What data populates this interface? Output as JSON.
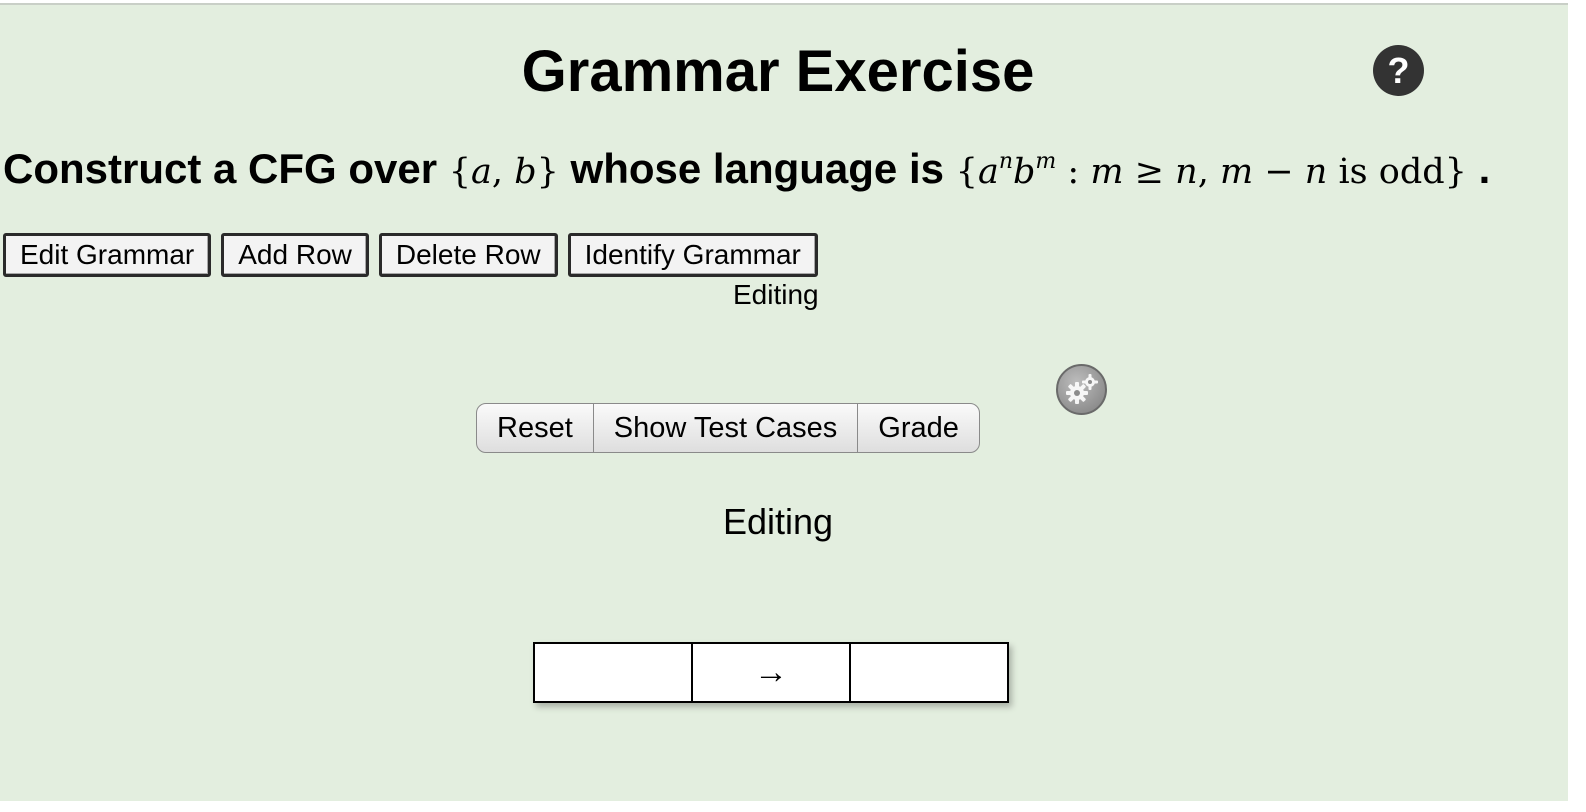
{
  "header": {
    "title": "Grammar Exercise",
    "help_label": "?"
  },
  "prompt": {
    "prefix": "Construct a CFG over",
    "alphabet": {
      "open": "{",
      "a": "a",
      "sep": ",",
      "b": "b",
      "close": "}"
    },
    "middle": "whose language is",
    "language": {
      "open": "{",
      "a": "a",
      "exp_n": "n",
      "b": "b",
      "exp_m": "m",
      "colon": ":",
      "m1": "m",
      "geq": "≥",
      "n1": "n",
      "comma": ",",
      "m2": "m",
      "minus": "−",
      "n2": "n",
      "is_odd": "is odd",
      "close": "}"
    },
    "suffix": "."
  },
  "toolbar": {
    "edit_grammar": "Edit Grammar",
    "add_row": "Add Row",
    "delete_row": "Delete Row",
    "identify_grammar": "Identify Grammar"
  },
  "status_small": "Editing",
  "actions": {
    "reset": "Reset",
    "show_test_cases": "Show Test Cases",
    "grade": "Grade"
  },
  "status_large": "Editing",
  "grammar_rows": [
    {
      "lhs": "",
      "arrow": "→",
      "rhs": ""
    }
  ],
  "icons": {
    "help": "help-icon",
    "settings": "gear-icon"
  },
  "colors": {
    "background": "#e3eedf",
    "help_icon": "#333333"
  }
}
